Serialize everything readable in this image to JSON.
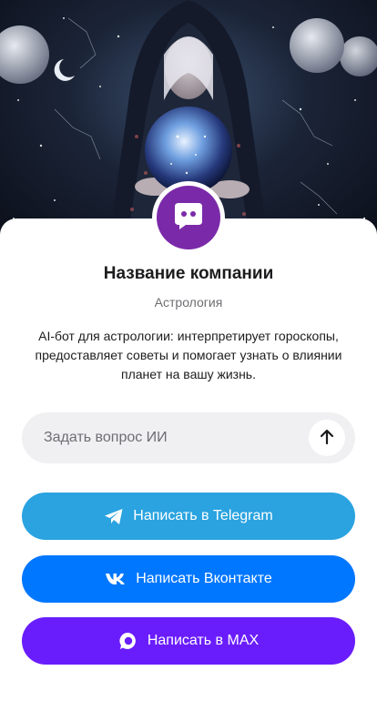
{
  "hero": {
    "image": "astrologer-crystal-ball-illustration"
  },
  "profile": {
    "avatar_icon": "chat-bot-icon",
    "company_name": "Название компании",
    "category": "Астрология",
    "description": "AI-бот для астрологии: интерпретирует гороскопы, предоставляет советы и помогает узнать о влиянии планет на вашу жизнь."
  },
  "ask": {
    "placeholder": "Задать вопрос ИИ",
    "value": "",
    "send_icon": "arrow-up-icon"
  },
  "actions": {
    "telegram": {
      "label": "Написать в Telegram",
      "icon": "telegram-icon"
    },
    "vk": {
      "label": "Написать Вконтакте",
      "icon": "vk-icon"
    },
    "max": {
      "label": "Написать в MAX",
      "icon": "max-icon"
    }
  },
  "colors": {
    "avatar": "#7a2aa8",
    "telegram": "#2aa3e0",
    "vk": "#0077ff",
    "max": "#6a1dfc"
  }
}
